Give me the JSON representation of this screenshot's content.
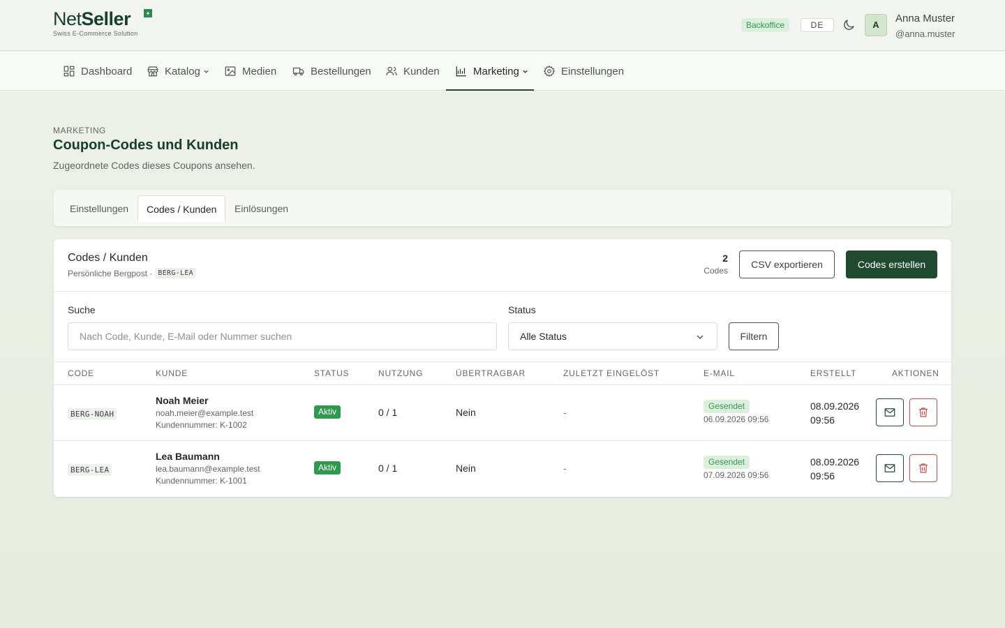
{
  "brand": {
    "name_light": "Net",
    "name_bold": "Seller",
    "tagline": "Swiss E-Commerce Solution",
    "corner_mark": "+"
  },
  "header": {
    "env_badge": "Backoffice",
    "language": "DE",
    "avatar_initial": "A",
    "user_name": "Anna Muster",
    "user_handle": "@anna.muster"
  },
  "nav": {
    "items": [
      {
        "label": "Dashboard",
        "icon": "dashboard-icon"
      },
      {
        "label": "Katalog",
        "icon": "store-icon",
        "has_dropdown": true
      },
      {
        "label": "Medien",
        "icon": "image-icon"
      },
      {
        "label": "Bestellungen",
        "icon": "truck-icon"
      },
      {
        "label": "Kunden",
        "icon": "users-icon"
      },
      {
        "label": "Marketing",
        "icon": "chart-icon",
        "has_dropdown": true,
        "active": true
      },
      {
        "label": "Einstellungen",
        "icon": "gear-icon"
      }
    ]
  },
  "page": {
    "eyebrow": "MARKETING",
    "title": "Coupon-Codes und Kunden",
    "subtitle": "Zugeordnete Codes dieses Coupons ansehen."
  },
  "tabs": [
    {
      "label": "Einstellungen",
      "active": false
    },
    {
      "label": "Codes / Kunden",
      "active": true
    },
    {
      "label": "Einlösungen",
      "active": false
    }
  ],
  "card": {
    "title": "Codes / Kunden",
    "subtitle": "Persönliche Bergpost ·",
    "coupon_code": "BERG-LEA",
    "count": "2",
    "count_label": "Codes",
    "export_button": "CSV exportieren",
    "create_button": "Codes erstellen"
  },
  "filters": {
    "search_label": "Suche",
    "search_placeholder": "Nach Code, Kunde, E-Mail oder Nummer suchen",
    "status_label": "Status",
    "status_value": "Alle Status",
    "filter_button": "Filtern"
  },
  "table": {
    "headers": [
      "CODE",
      "KUNDE",
      "STATUS",
      "NUTZUNG",
      "ÜBERTRAGBAR",
      "ZULETZT EINGELÖST",
      "E-MAIL",
      "ERSTELLT",
      "AKTIONEN"
    ],
    "rows": [
      {
        "code": "BERG-NOAH",
        "customer_name": "Noah Meier",
        "customer_email": "noah.meier@example.test",
        "customer_number": "Kundennummer: K-1002",
        "status": "Aktiv",
        "usage": "0 / 1",
        "transferable": "Nein",
        "last_redeemed": "-",
        "email_status": "Gesendet",
        "email_date": "06.09.2026 09:56",
        "created_date": "08.09.2026",
        "created_time": "09:56"
      },
      {
        "code": "BERG-LEA",
        "customer_name": "Lea Baumann",
        "customer_email": "lea.baumann@example.test",
        "customer_number": "Kundennummer: K-1001",
        "status": "Aktiv",
        "usage": "0 / 1",
        "transferable": "Nein",
        "last_redeemed": "-",
        "email_status": "Gesendet",
        "email_date": "07.09.2026 09:56",
        "created_date": "08.09.2026",
        "created_time": "09:56"
      }
    ]
  },
  "colors": {
    "brand_dark": "#1f4a30",
    "success": "#2f9a4e",
    "danger": "#c84a4a",
    "background": "#eef2ea"
  }
}
